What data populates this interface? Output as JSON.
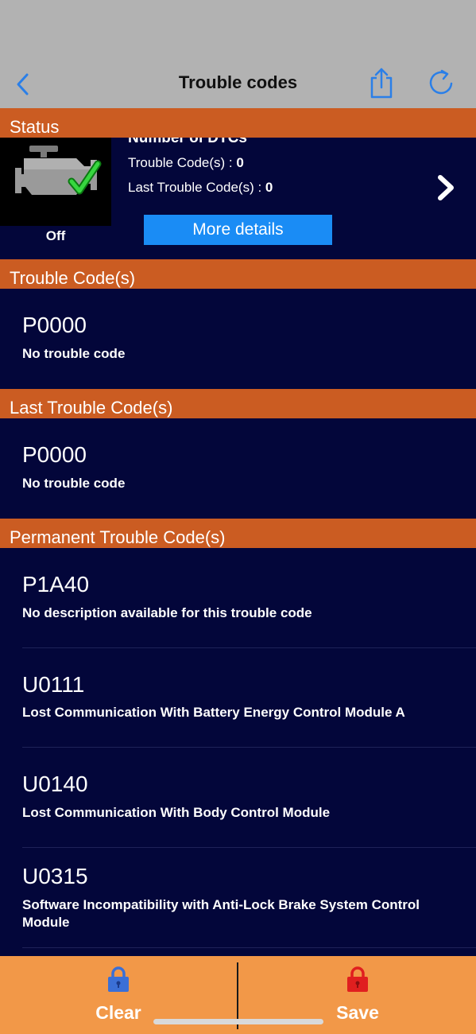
{
  "nav": {
    "title": "Trouble codes",
    "back_icon": "chevron-left-icon",
    "share_icon": "share-icon",
    "refresh_icon": "refresh-icon",
    "accent": "#2a7fe8"
  },
  "status": {
    "header": "Status",
    "engine_icon": "check-engine-icon",
    "engine_state": "Off",
    "dtc_title": "Number of DTCs",
    "trouble_codes_label": "Trouble Code(s) : ",
    "trouble_codes_value": "0",
    "last_trouble_codes_label": "Last Trouble Code(s) : ",
    "last_trouble_codes_value": "0",
    "more_details_label": "More details",
    "chevron_icon": "chevron-right-icon"
  },
  "trouble_codes": {
    "header": "Trouble Code(s)",
    "items": [
      {
        "code": "P0000",
        "description": "No trouble code"
      }
    ]
  },
  "last_trouble_codes": {
    "header": "Last Trouble Code(s)",
    "items": [
      {
        "code": "P0000",
        "description": "No trouble code"
      }
    ]
  },
  "permanent_trouble_codes": {
    "header": "Permanent Trouble Code(s)",
    "items": [
      {
        "code": "P1A40",
        "description": "No description available for this trouble code"
      },
      {
        "code": "U0111",
        "description": "Lost Communication With Battery Energy Control Module A"
      },
      {
        "code": "U0140",
        "description": "Lost Communication With Body Control Module"
      },
      {
        "code": "U0315",
        "description": "Software Incompatibility with Anti-Lock Brake System Control Module"
      }
    ]
  },
  "bottom": {
    "clear_label": "Clear",
    "clear_icon": "lock-icon",
    "clear_color": "#3b6fd6",
    "save_label": "Save",
    "save_icon": "lock-icon",
    "save_color": "#e01f1f"
  },
  "colors": {
    "section_header": "#cb5c22",
    "panel_bg": "#03063a",
    "bottom_bar": "#f29848",
    "button_blue": "#1a8cf5"
  }
}
